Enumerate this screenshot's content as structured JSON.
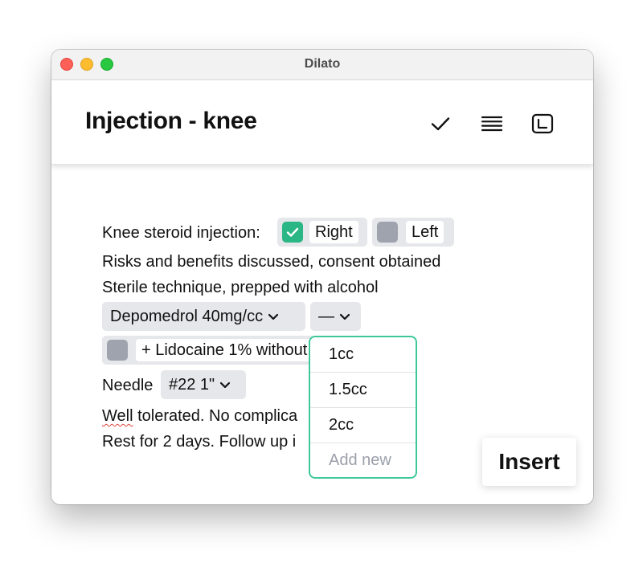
{
  "window": {
    "title": "Dilato"
  },
  "header": {
    "title": "Injection - knee",
    "icons": [
      "checkmark-icon",
      "list-lines-icon",
      "sidebar-panel-icon"
    ]
  },
  "template": {
    "line1": {
      "prefix": "Knee steroid injection:",
      "options": [
        {
          "label": "Right",
          "checked": true
        },
        {
          "label": "Left",
          "checked": false
        }
      ]
    },
    "line2": "Risks and benefits discussed, consent obtained",
    "line3": "Sterile technique, prepped with alcohol",
    "medication_select": {
      "value": "Depomedrol 40mg/cc"
    },
    "dose_select": {
      "value": "—"
    },
    "lidocaine": {
      "label": "+ Lidocaine 1% without",
      "checked": false
    },
    "needle": {
      "label": "Needle",
      "value": "#22 1\""
    },
    "line7": {
      "word1": "Well",
      "rest": " tolerated. No complica"
    },
    "line8": "Rest for 2 days. Follow up i"
  },
  "dose_dropdown": {
    "options": [
      "1cc",
      "1.5cc",
      "2cc"
    ],
    "add_new_placeholder": "Add new"
  },
  "insert_button": {
    "label": "Insert"
  },
  "colors": {
    "accent_green": "#2bb685",
    "dropdown_border": "#3ec89a",
    "chip_bg": "#e6e7ea",
    "unchecked_box": "#9ea3ad"
  }
}
